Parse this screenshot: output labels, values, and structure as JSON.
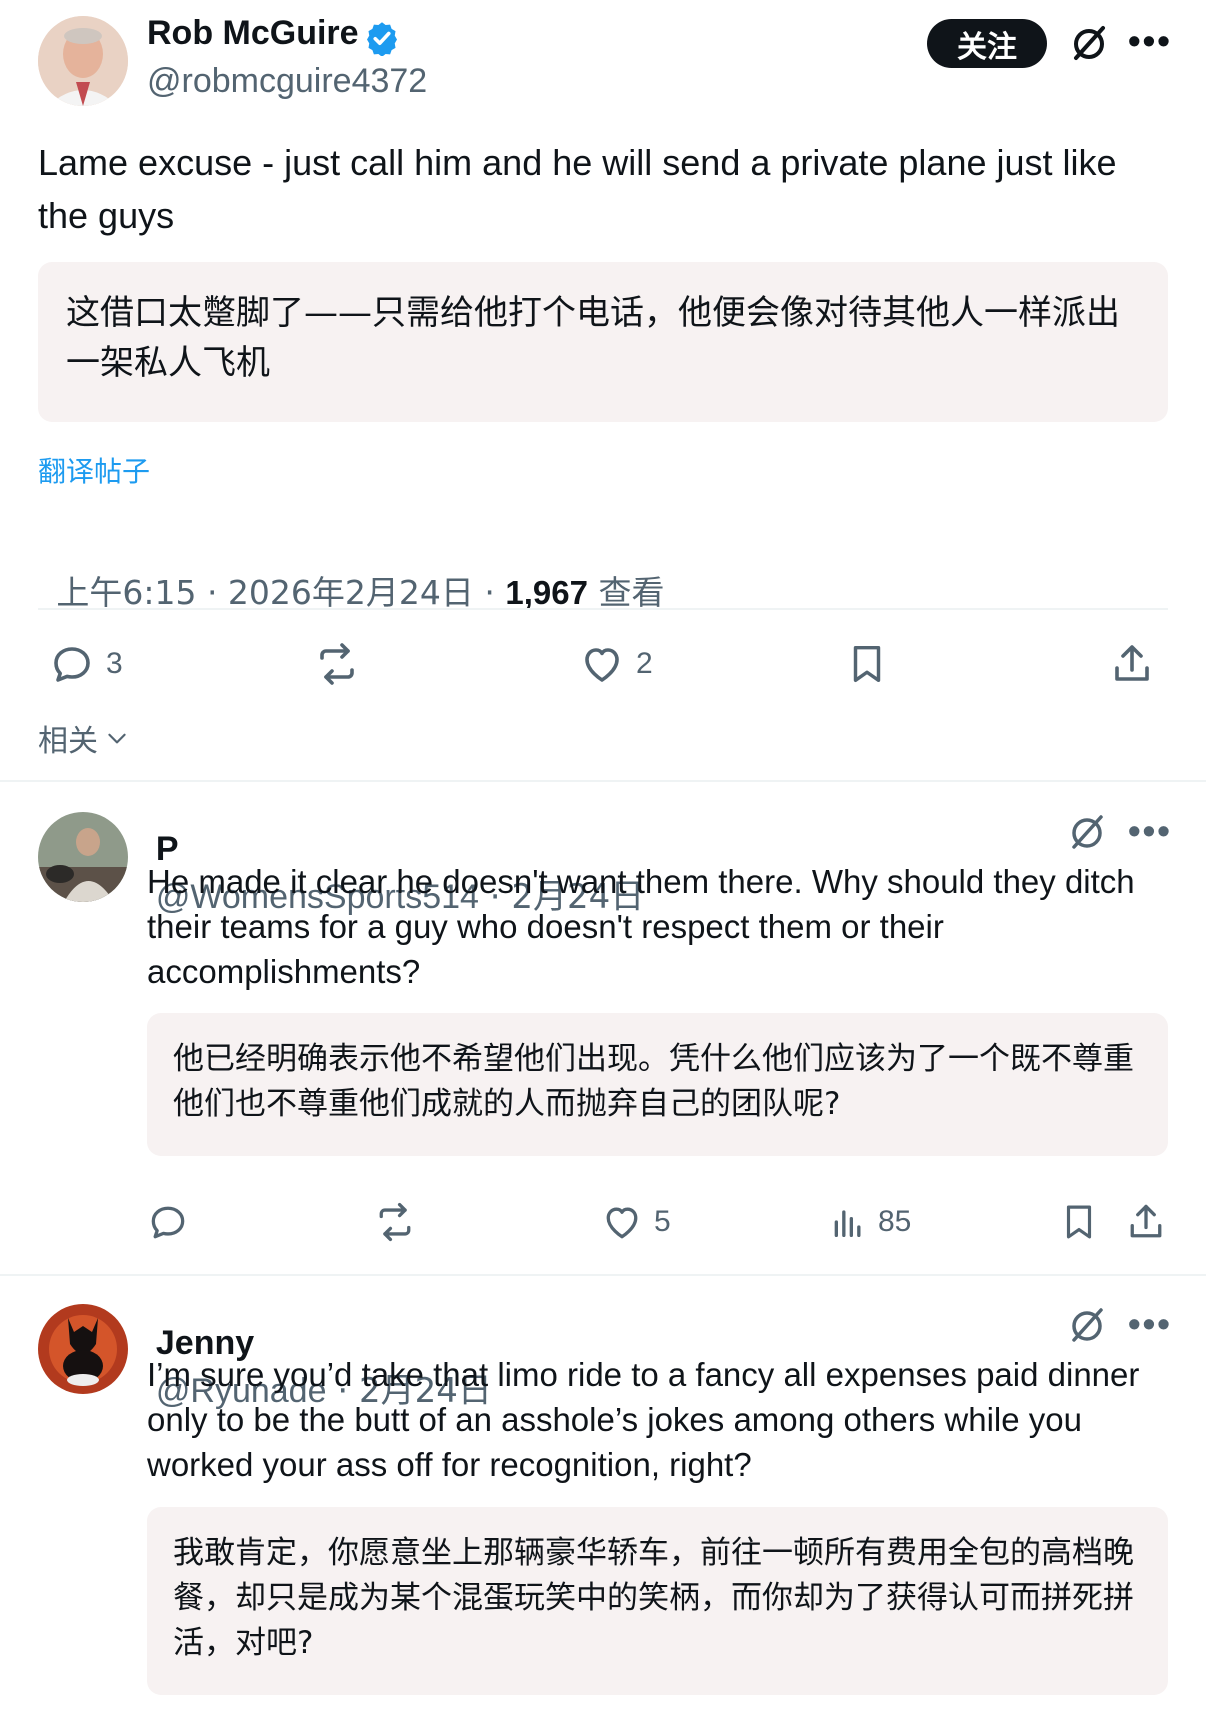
{
  "main_post": {
    "author_name": "Rob McGuire",
    "handle": "@robmcguire4372",
    "follow_label": "关注",
    "text": "Lame excuse - just call him and he will send a private plane just like the guys",
    "translation": "这借口太蹩脚了——只需给他打个电话，他便会像对待其他人一样派出一架私人飞机",
    "translate_link": "翻译帖子",
    "timestamp": "上午6:15 · 2026年2月24日 · ",
    "views_count": "1,967",
    "views_label": " 查看",
    "reply_count": "3",
    "like_count": "2",
    "related_label": "相关"
  },
  "replies": [
    {
      "author_name": "P",
      "handle": "@WomensSports514",
      "date": " · 2月24日",
      "text": "He made it clear he doesn't want them there. Why should they ditch their teams for a guy who doesn't respect them or their accomplishments?",
      "translation": "他已经明确表示他不希望他们出现。凭什么他们应该为了一个既不尊重他们也不尊重他们成就的人而抛弃自己的团队呢?",
      "like_count": "5",
      "views_count": "85"
    },
    {
      "author_name": "Jenny",
      "handle": "@Ryunade",
      "date": " · 2月24日",
      "text": "I’m sure you’d take that limo ride to a fancy all expenses paid dinner only to be the butt of an asshole’s jokes among others while you worked your ass off for recognition, right?",
      "translation": "我敢肯定，你愿意坐上那辆豪华轿车，前往一顿所有费用全包的高档晚餐，却只是成为某个混蛋玩笑中的笑柄，而你却为了获得认可而拼死拼活，对吧?"
    }
  ],
  "colors": {
    "link_blue": "#1d9bf0",
    "muted": "#536471",
    "translation_bg": "#f7f2f2"
  }
}
